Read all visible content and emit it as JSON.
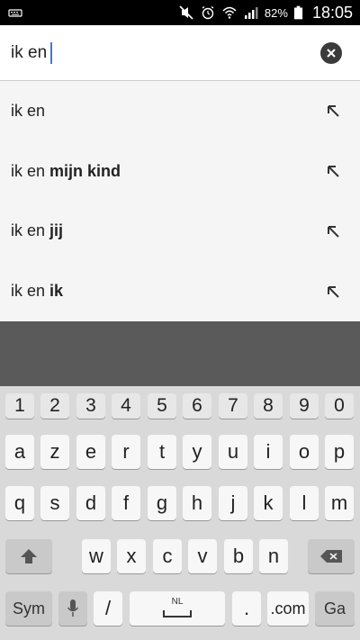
{
  "status": {
    "battery_pct": "82%",
    "time": "18:05"
  },
  "search": {
    "query": "ik en"
  },
  "suggestions": [
    {
      "prefix": "ik en",
      "bold": ""
    },
    {
      "prefix": "ik en ",
      "bold": "mijn kind"
    },
    {
      "prefix": "ik en ",
      "bold": "jij"
    },
    {
      "prefix": "ik en ",
      "bold": "ik"
    }
  ],
  "keyboard": {
    "row_numbers": [
      "1",
      "2",
      "3",
      "4",
      "5",
      "6",
      "7",
      "8",
      "9",
      "0"
    ],
    "row1": [
      "a",
      "z",
      "e",
      "r",
      "t",
      "y",
      "u",
      "i",
      "o",
      "p"
    ],
    "row2": [
      "q",
      "s",
      "d",
      "f",
      "g",
      "h",
      "j",
      "k",
      "l",
      "m"
    ],
    "row3": [
      "w",
      "x",
      "c",
      "v",
      "b",
      "n"
    ],
    "sym": "Sym",
    "slash": "/",
    "space_lang": "NL",
    "dot": ".",
    "dotcom": ".com",
    "go": "Ga"
  },
  "colors": {
    "status_bar": "#000000",
    "suggestion_bg": "#f5f5f5",
    "gap": "#5a5a5a",
    "keyboard_bg": "#d9d9d9",
    "caret": "#3f7bd4"
  }
}
